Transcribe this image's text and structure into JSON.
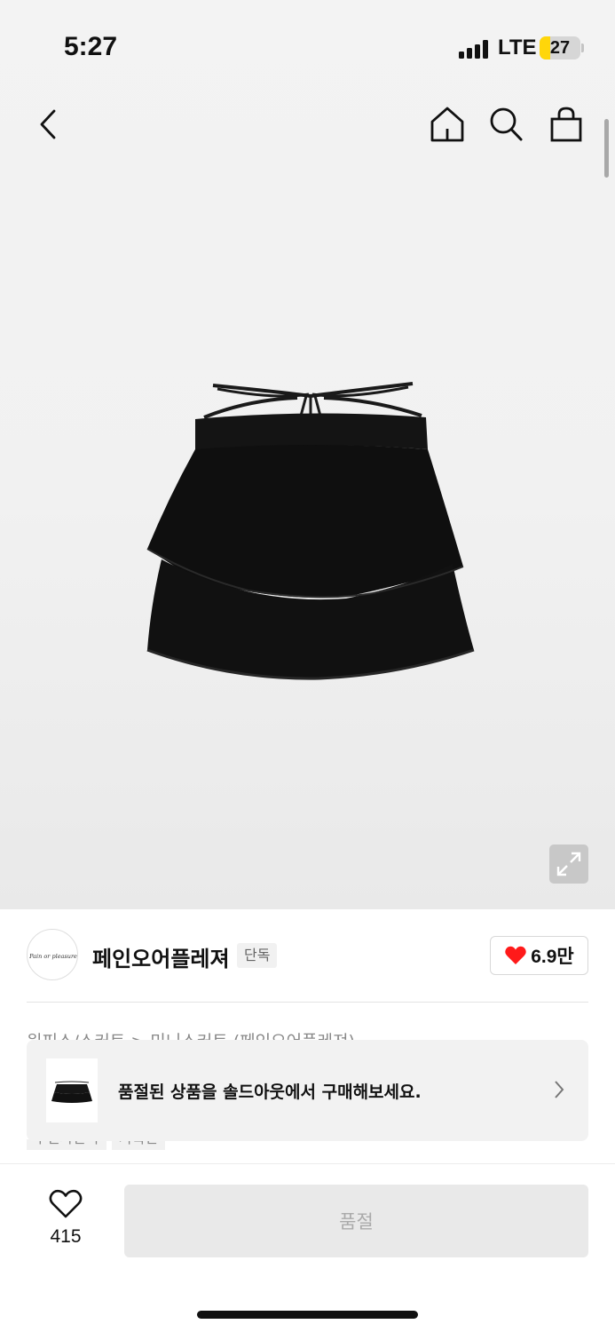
{
  "status_bar": {
    "time": "5:27",
    "network": "LTE",
    "battery_level": "27",
    "battery_color": "#ffd60a"
  },
  "header": {
    "back_icon": "chevron-left-icon",
    "home_icon": "home-icon",
    "search_icon": "search-icon",
    "cart_icon": "shopping-bag-icon"
  },
  "product": {
    "image_alt": "black tiered ruffle knit mini skirt with criss-cross straps",
    "expand_icon": "expand-icon"
  },
  "brand": {
    "logo_text": "Pain or pleasure",
    "name": "페인오어플레져",
    "exclusive_tag": "단독",
    "like_count": "6.9만",
    "heart_color": "#ff1a1a"
  },
  "details": {
    "category": "원피스/스커트 > 미니스커트 (페인오어플레져)",
    "tags": [
      "무신사단독",
      "기획전"
    ]
  },
  "toast": {
    "message": "품절된 상품을 솔드아웃에서 구매해보세요."
  },
  "bottom_bar": {
    "wish_count": "415",
    "buy_button_label": "품절"
  }
}
